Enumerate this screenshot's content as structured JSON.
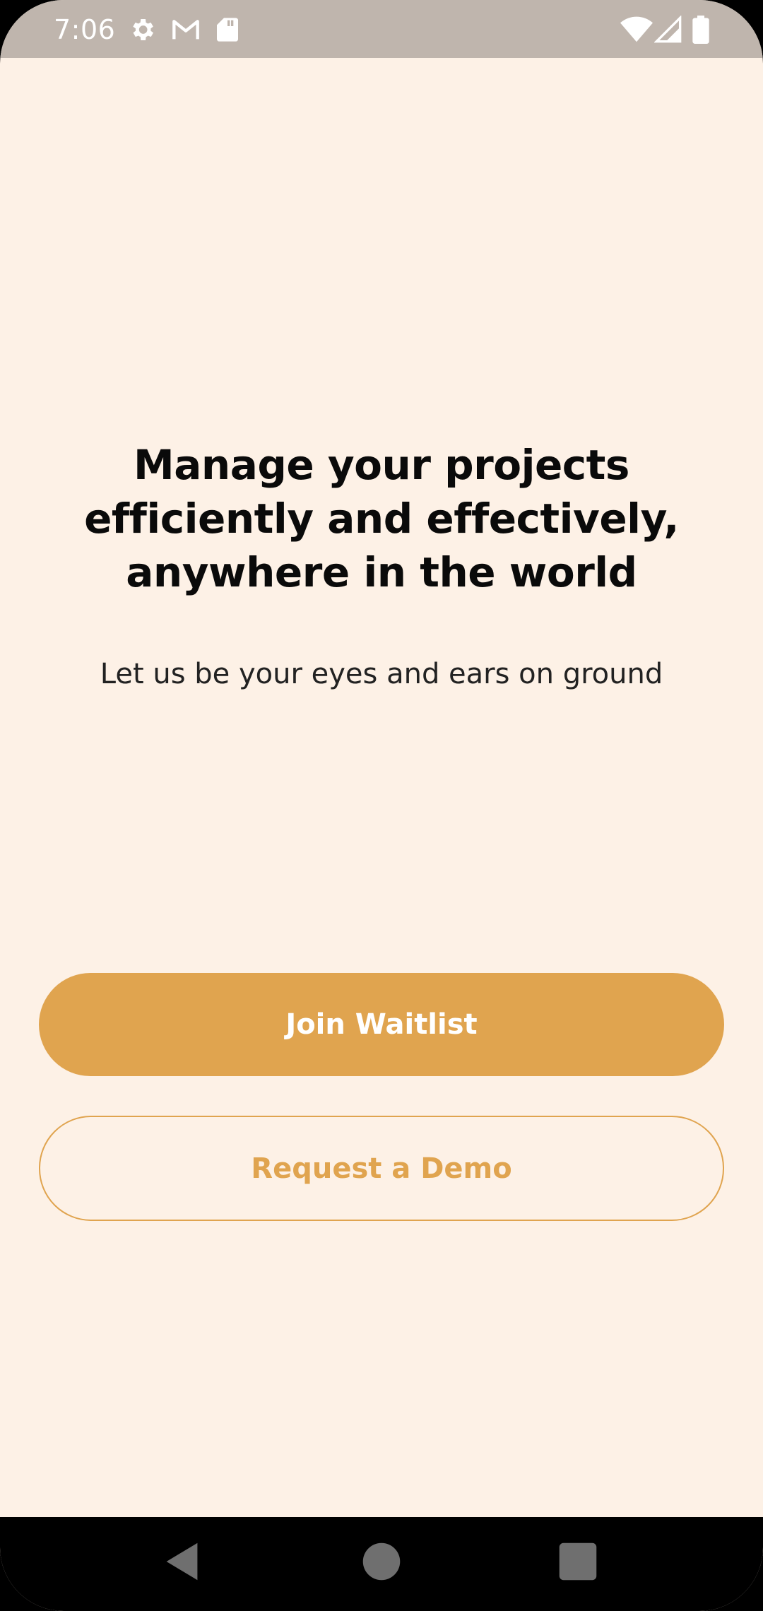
{
  "status_bar": {
    "time": "7:06",
    "left_icons": [
      "settings-icon",
      "gmail-icon",
      "sd-card-icon"
    ],
    "right_icons": [
      "wifi-icon",
      "cell-signal-icon",
      "battery-icon"
    ],
    "background": "#bfb5ad"
  },
  "main": {
    "headline": "Manage your projects efficiently and effectively, anywhere in the world",
    "subtitle": "Let us be your eyes and ears on ground",
    "background": "#fdf1e6"
  },
  "actions": {
    "primary_label": "Join Waitlist",
    "secondary_label": "Request a Demo",
    "accent_color": "#e0a44f"
  },
  "nav_bar": {
    "buttons": [
      "back-icon",
      "home-icon",
      "recents-icon"
    ]
  }
}
